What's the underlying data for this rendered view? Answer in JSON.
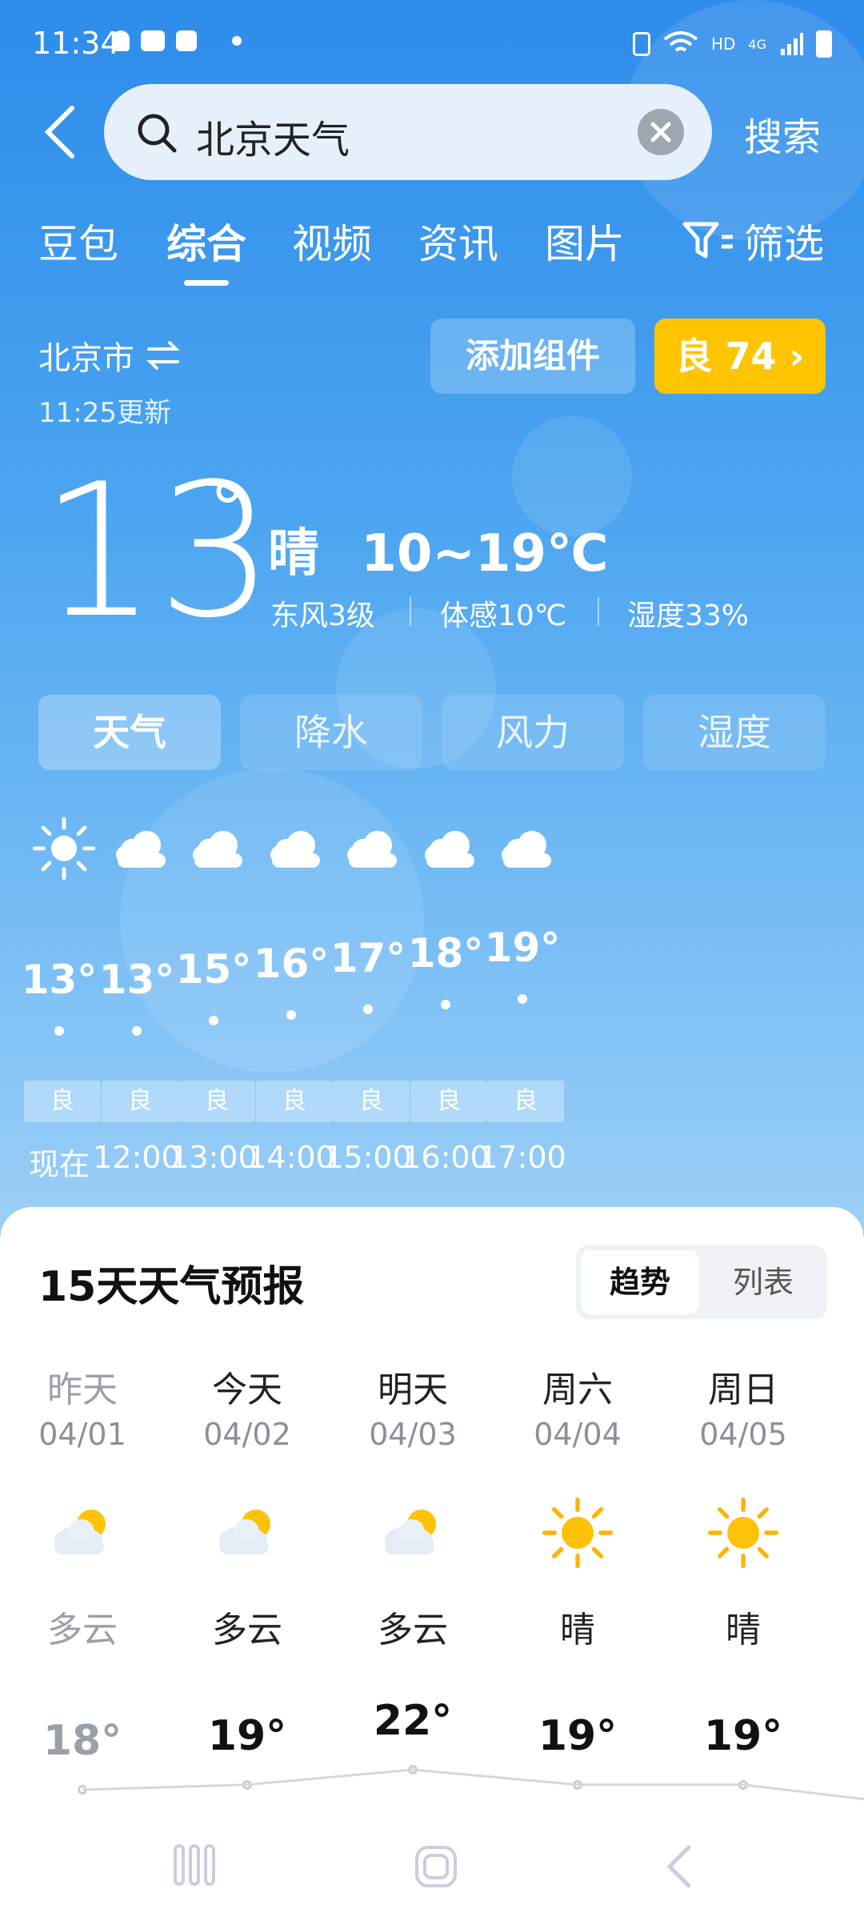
{
  "status_bar": {
    "time": "11:34",
    "network": "HD",
    "signal": "4G"
  },
  "search": {
    "query": "北京天气",
    "submit_label": "搜索"
  },
  "tabs": [
    "豆包",
    "综合",
    "视频",
    "资讯",
    "图片",
    "筛选"
  ],
  "location": {
    "city": "北京市",
    "updated": "11:25更新"
  },
  "add_widget_label": "添加组件",
  "aqi": {
    "label": "良 74",
    "color": "#ffc400"
  },
  "current": {
    "temp": "13",
    "deg": "°",
    "condition": "晴",
    "range": "10~19℃",
    "wind": "东风3级",
    "feels": "体感10℃",
    "humidity": "湿度33%"
  },
  "panel_tabs": [
    "天气",
    "降水",
    "风力",
    "湿度"
  ],
  "hourly": [
    {
      "time": "现在",
      "temp": "13°",
      "icon": "sun-icon",
      "aqi": "良"
    },
    {
      "time": "12:00",
      "temp": "13°",
      "icon": "cloud-icon",
      "aqi": "良"
    },
    {
      "time": "13:00",
      "temp": "15°",
      "icon": "cloud-icon",
      "aqi": "良"
    },
    {
      "time": "14:00",
      "temp": "16°",
      "icon": "cloud-icon",
      "aqi": "良"
    },
    {
      "time": "15:00",
      "temp": "17°",
      "icon": "cloud-icon",
      "aqi": "良"
    },
    {
      "time": "16:00",
      "temp": "18°",
      "icon": "cloud-icon",
      "aqi": "良"
    },
    {
      "time": "17:00",
      "temp": "19°",
      "icon": "cloud-icon",
      "aqi": "良"
    }
  ],
  "forecast": {
    "title": "15天天气预报",
    "toggle": [
      "趋势",
      "列表"
    ],
    "days": [
      {
        "name": "昨天",
        "date": "04/01",
        "icon": "partly-cloudy-icon",
        "cond": "多云",
        "high": "18°"
      },
      {
        "name": "今天",
        "date": "04/02",
        "icon": "partly-cloudy-icon",
        "cond": "多云",
        "high": "19°"
      },
      {
        "name": "明天",
        "date": "04/03",
        "icon": "partly-cloudy-icon",
        "cond": "多云",
        "high": "22°"
      },
      {
        "name": "周六",
        "date": "04/04",
        "icon": "sun-icon",
        "cond": "晴",
        "high": "19°"
      },
      {
        "name": "周日",
        "date": "04/05",
        "icon": "sun-icon",
        "cond": "晴",
        "high": "19°"
      }
    ]
  }
}
